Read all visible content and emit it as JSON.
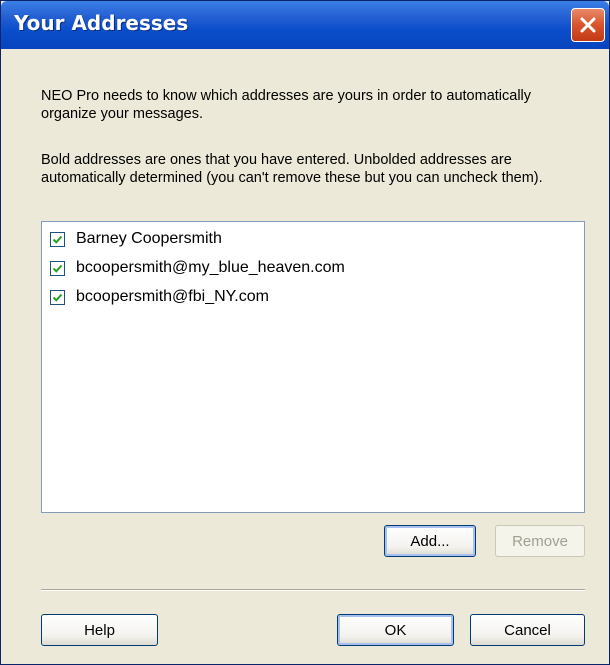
{
  "window": {
    "title": "Your Addresses"
  },
  "intro_text": "NEO Pro needs to know which addresses are yours in order to automatically organize your messages.",
  "note_text": "Bold addresses are ones that you have entered. Unbolded addresses are automatically determined (you can't remove these but you can uncheck them).",
  "addresses": [
    {
      "label": "Barney Coopersmith",
      "checked": true
    },
    {
      "label": "bcoopersmith@my_blue_heaven.com",
      "checked": true
    },
    {
      "label": "bcoopersmith@fbi_NY.com",
      "checked": true
    }
  ],
  "buttons": {
    "add": "Add...",
    "remove": "Remove",
    "help": "Help",
    "ok": "OK",
    "cancel": "Cancel"
  },
  "icons": {
    "close": "close-icon",
    "checkbox": "checkmark-icon"
  },
  "colors": {
    "titlebar": "#0a4ecb",
    "dialog_bg": "#ece9d8",
    "close_red": "#d8542d",
    "checkmark_green": "#21a121"
  }
}
